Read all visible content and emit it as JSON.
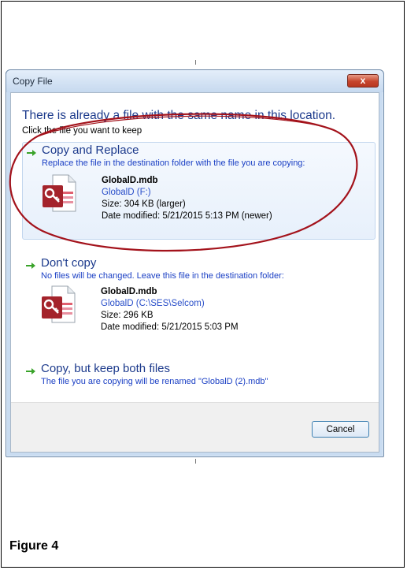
{
  "dialog": {
    "title": "Copy File",
    "close_label": "x",
    "heading": "There is already a file with the same name in this location.",
    "subheading": "Click the file you want to keep",
    "options": [
      {
        "title": "Copy and Replace",
        "description": "Replace the file in the destination folder with the file you are copying:",
        "file": {
          "name": "GlobalD.mdb",
          "location": "GlobalD (F:)",
          "size": "Size: 304 KB (larger)",
          "modified": "Date modified: 5/21/2015 5:13 PM (newer)"
        }
      },
      {
        "title": "Don't copy",
        "description": "No files will be changed. Leave this file in the destination folder:",
        "file": {
          "name": "GlobalD.mdb",
          "location": "GlobalD (C:\\SES\\Selcom)",
          "size": "Size: 296 KB",
          "modified": "Date modified: 5/21/2015 5:03 PM"
        }
      },
      {
        "title": "Copy, but keep both files",
        "description": "The file you are copying will be renamed \"GlobalD (2).mdb\""
      }
    ],
    "cancel_label": "Cancel"
  },
  "caption": "Figure 4",
  "colors": {
    "link_blue": "#1c3a8c",
    "desc_blue": "#1a3fc4",
    "green_arrow": "#3aa32a",
    "annotation_red": "#a3121b"
  },
  "icons": [
    "green-arrow-icon",
    "access-database-file-icon",
    "close-icon"
  ]
}
